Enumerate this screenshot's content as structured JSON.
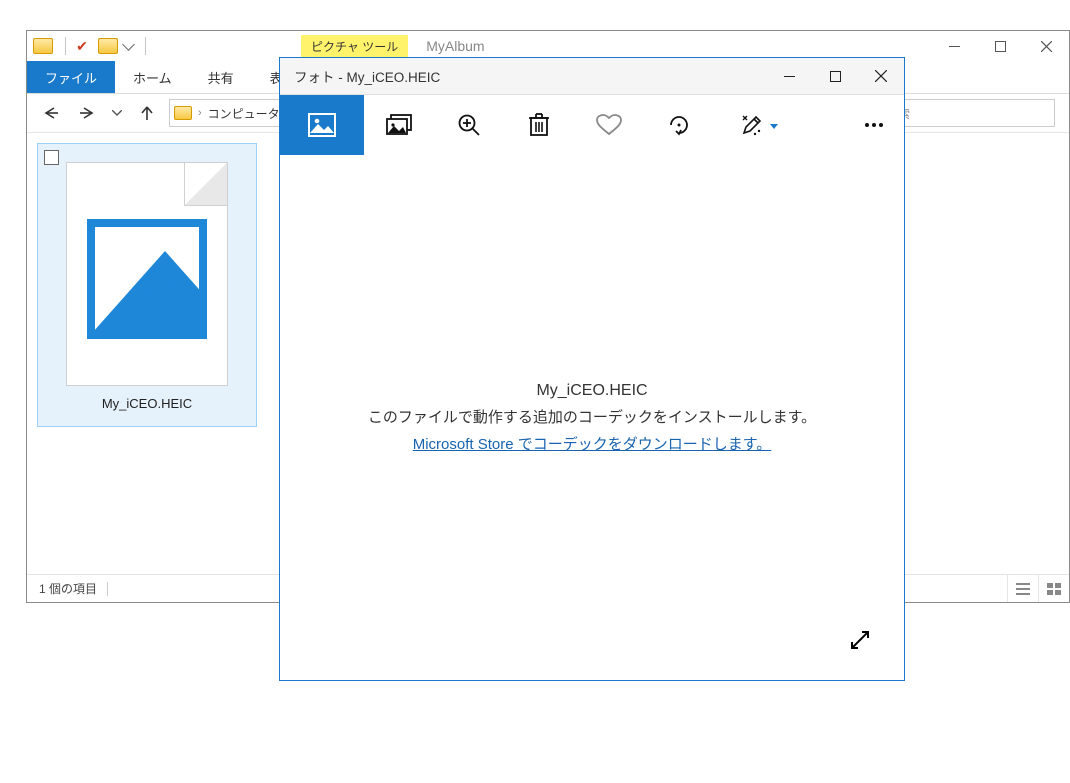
{
  "explorer": {
    "context_tab": "ピクチャ ツール",
    "title": "MyAlbum",
    "tabs": {
      "file": "ファイル",
      "home": "ホーム",
      "share": "共有",
      "view": "表示"
    },
    "breadcrumb": {
      "root": "コンピュータ"
    },
    "search_placeholder": "の検索",
    "file": {
      "name": "My_iCEO.HEIC"
    },
    "status": "1 個の項目"
  },
  "photos": {
    "title": "フォト - My_iCEO.HEIC",
    "content": {
      "filename": "My_iCEO.HEIC",
      "message": "このファイルで動作する追加のコーデックをインストールします。",
      "link": "Microsoft Store でコーデックをダウンロードします。"
    }
  }
}
